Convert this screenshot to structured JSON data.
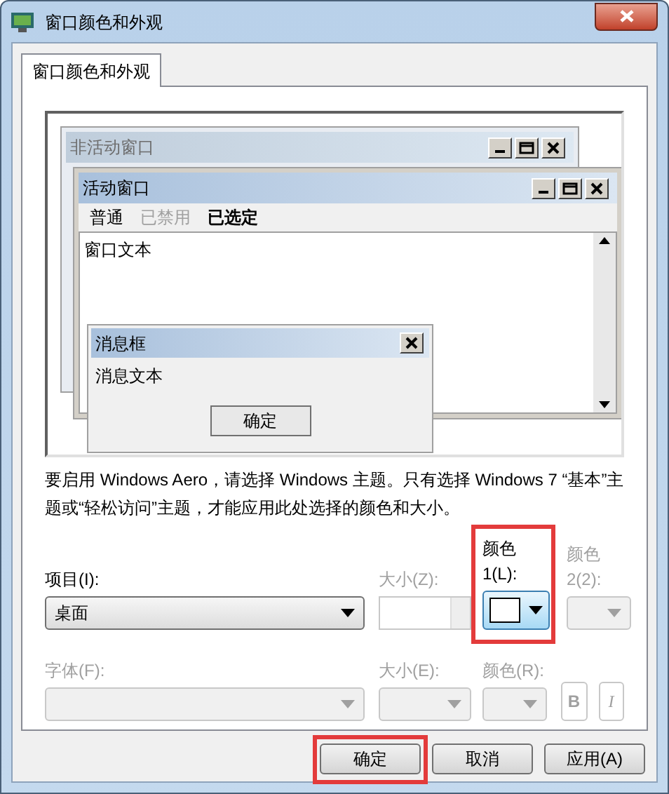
{
  "window": {
    "title": "窗口颜色和外观"
  },
  "tabs": [
    {
      "label": "窗口颜色和外观",
      "selected": true
    }
  ],
  "preview": {
    "inactive_window": {
      "title": "非活动窗口"
    },
    "active_window": {
      "title": "活动窗口",
      "menu": [
        {
          "label": "普通",
          "disabled": false,
          "selected": false
        },
        {
          "label": "已禁用",
          "disabled": true,
          "selected": false
        },
        {
          "label": "已选定",
          "disabled": false,
          "selected": true
        }
      ],
      "text": "窗口文本"
    },
    "message_box": {
      "title": "消息框",
      "text": "消息文本",
      "button": "确定"
    }
  },
  "note": "要启用 Windows Aero，请选择 Windows 主题。只有选择 Windows 7 “基本”主题或“轻松访问”主题，才能应用此处选择的颜色和大小。",
  "item": {
    "label": "项目(I):",
    "value": "桌面"
  },
  "item_size": {
    "label": "大小(Z):",
    "disabled": true
  },
  "color1": {
    "label": "颜色 1(L):",
    "disabled": false,
    "highlighted": true
  },
  "color2": {
    "label": "颜色 2(2):",
    "disabled": true
  },
  "font": {
    "label": "字体(F):",
    "disabled": true
  },
  "font_size": {
    "label": "大小(E):",
    "disabled": true
  },
  "font_color": {
    "label": "颜色(R):",
    "disabled": true
  },
  "bold": {
    "label": "B",
    "disabled": true
  },
  "italic": {
    "label": "I",
    "disabled": true
  },
  "buttons": [
    {
      "label": "确定",
      "highlighted": true
    },
    {
      "label": "取消",
      "highlighted": false
    },
    {
      "label": "应用(A)",
      "highlighted": false
    }
  ]
}
